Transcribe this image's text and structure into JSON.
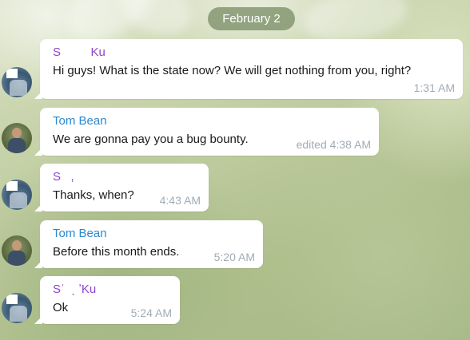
{
  "date_separator": "February 2",
  "messages": [
    {
      "sender": "S         Ku",
      "sender_color": "#8e44c9",
      "text": "Hi guys! What is the state now? We will get nothing from you, right?",
      "time": "1:31 AM"
    },
    {
      "sender": "Tom Bean",
      "sender_color": "#2b8ad0",
      "text": "We are gonna pay you a bug bounty.",
      "time": "edited 4:38 AM"
    },
    {
      "sender": "S   ,",
      "sender_color": "#8e44c9",
      "text": "Thanks, when?",
      "time": "4:43 AM"
    },
    {
      "sender": "Tom Bean",
      "sender_color": "#2b8ad0",
      "text": "Before this month ends.",
      "time": "5:20 AM"
    },
    {
      "sender": "Sʿ  ˎ ʼKu",
      "sender_color": "#8e44c9",
      "text": "Ok",
      "time": "5:24 AM"
    }
  ]
}
